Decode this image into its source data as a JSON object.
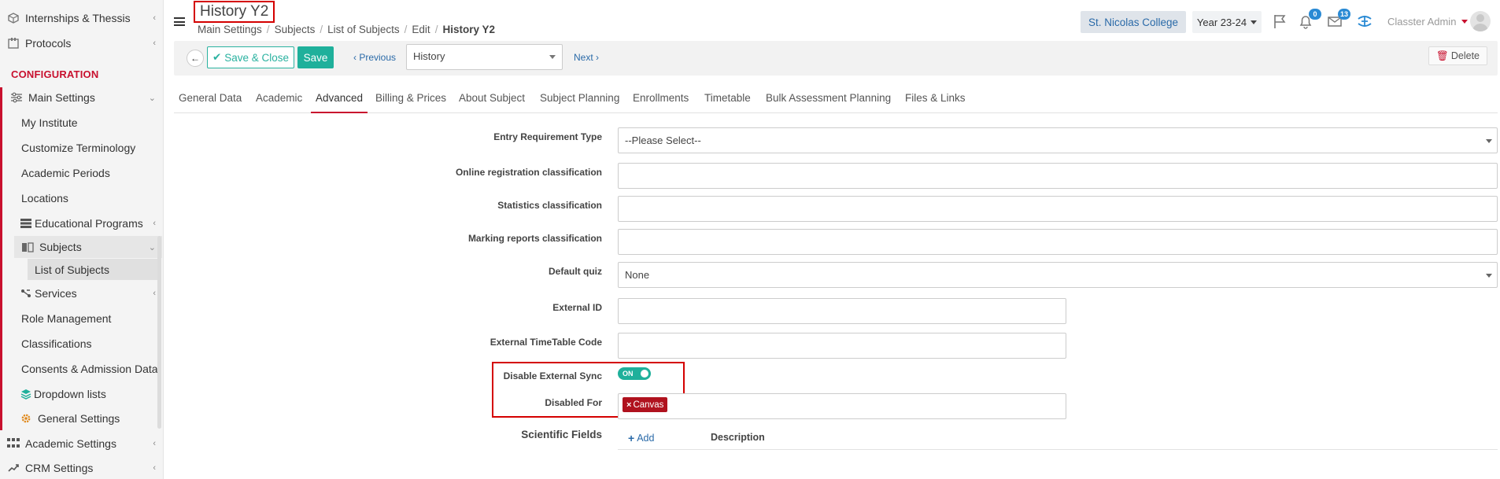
{
  "sidebar": {
    "items_top": [
      {
        "label": "Internships & Thessis",
        "icon": "box-icon"
      },
      {
        "label": "Protocols",
        "icon": "protocols-icon"
      }
    ],
    "section_title": "CONFIGURATION",
    "main_settings": {
      "label": "Main Settings",
      "icon": "sliders-icon"
    },
    "sub_items": [
      {
        "label": "My Institute"
      },
      {
        "label": "Customize Terminology"
      },
      {
        "label": "Academic Periods"
      },
      {
        "label": "Locations"
      },
      {
        "label": "Educational Programs",
        "icon": "programs-icon"
      }
    ],
    "subjects": {
      "label": "Subjects",
      "icon": "book-icon"
    },
    "list_of_subjects": {
      "label": "List of Subjects"
    },
    "services": {
      "label": "Services",
      "icon": "services-icon"
    },
    "more_items": [
      {
        "label": "Role Management"
      },
      {
        "label": "Classifications"
      },
      {
        "label": "Consents & Admission Data"
      }
    ],
    "dropdown_lists": {
      "label": "Dropdown lists",
      "icon": "layers-icon"
    },
    "general_settings": {
      "label": "General Settings",
      "icon": "gear-icon"
    },
    "academic_settings": {
      "label": "Academic Settings",
      "icon": "grid-icon"
    },
    "crm_settings": {
      "label": "CRM Settings",
      "icon": "crm-icon"
    }
  },
  "header": {
    "title": "History Y2",
    "breadcrumb": [
      "Main Settings",
      "Subjects",
      "List of Subjects",
      "Edit",
      "History Y2"
    ],
    "college": "St. Nicolas College",
    "year": "Year 23-24",
    "notifications_count": "0",
    "messages_count": "13",
    "user": "Classter Admin"
  },
  "toolbar": {
    "save_close_label": "Save & Close",
    "save_label": "Save",
    "previous_label": "Previous",
    "subject_select_value": "History",
    "next_label": "Next",
    "delete_label": "Delete"
  },
  "tabs": [
    {
      "label": "General Data"
    },
    {
      "label": "Academic"
    },
    {
      "label": "Advanced",
      "active": true
    },
    {
      "label": "Billing & Prices"
    },
    {
      "label": "About Subject"
    },
    {
      "label": "Subject Planning"
    },
    {
      "label": "Enrollments"
    },
    {
      "label": "Timetable"
    },
    {
      "label": "Bulk Assessment Planning"
    },
    {
      "label": "Files & Links"
    }
  ],
  "form": {
    "entry_requirement_type": {
      "label": "Entry Requirement Type",
      "value": "--Please Select--"
    },
    "online_registration_classification": {
      "label": "Online registration classification",
      "value": ""
    },
    "statistics_classification": {
      "label": "Statistics classification",
      "value": ""
    },
    "marking_reports_classification": {
      "label": "Marking reports classification",
      "value": ""
    },
    "default_quiz": {
      "label": "Default quiz",
      "value": "None"
    },
    "external_id": {
      "label": "External ID",
      "value": ""
    },
    "external_timetable_code": {
      "label": "External TimeTable Code",
      "value": ""
    },
    "disable_external_sync": {
      "label": "Disable External Sync",
      "value": "ON"
    },
    "disabled_for": {
      "label": "Disabled For",
      "tag": "Canvas"
    },
    "scientific_fields": {
      "label": "Scientific Fields",
      "add_label": "Add",
      "description_header": "Description"
    }
  },
  "colors": {
    "brand_red": "#c8102e",
    "accent_teal": "#1fb09b",
    "link_blue": "#2a6aa8",
    "badge_blue": "#2a8ad4",
    "tag_red": "#b0121e"
  }
}
